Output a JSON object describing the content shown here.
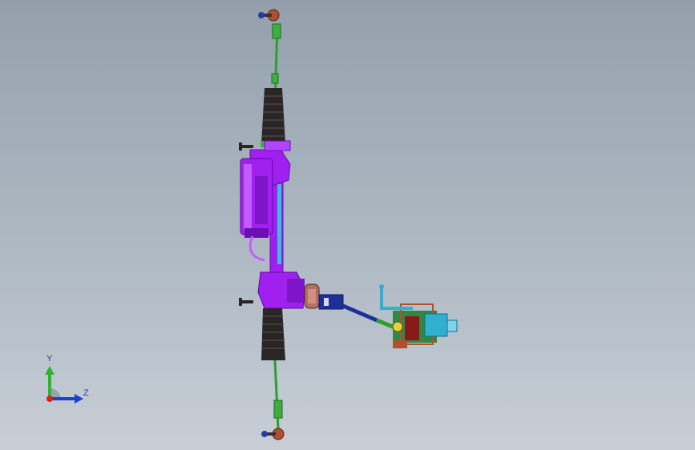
{
  "viewport": {
    "background_top": "#93a0ac",
    "background_bottom": "#c7ced6"
  },
  "model": {
    "colors": {
      "housing": "#a020f0",
      "housing_dark": "#6a0fb0",
      "tie_rod": "#2e9e2e",
      "boot": "#2b2626",
      "tie_rod_end": "#b05030",
      "intermediate_shaft": "#1f2f9a",
      "column_bracket": "#30b0d0",
      "column_parts": "#1e7a2a"
    }
  },
  "triad": {
    "y_label": "Y",
    "z_label": "Z",
    "y_color": "#2db52d",
    "z_color": "#1f3fd6",
    "x_color": "#d62020"
  }
}
